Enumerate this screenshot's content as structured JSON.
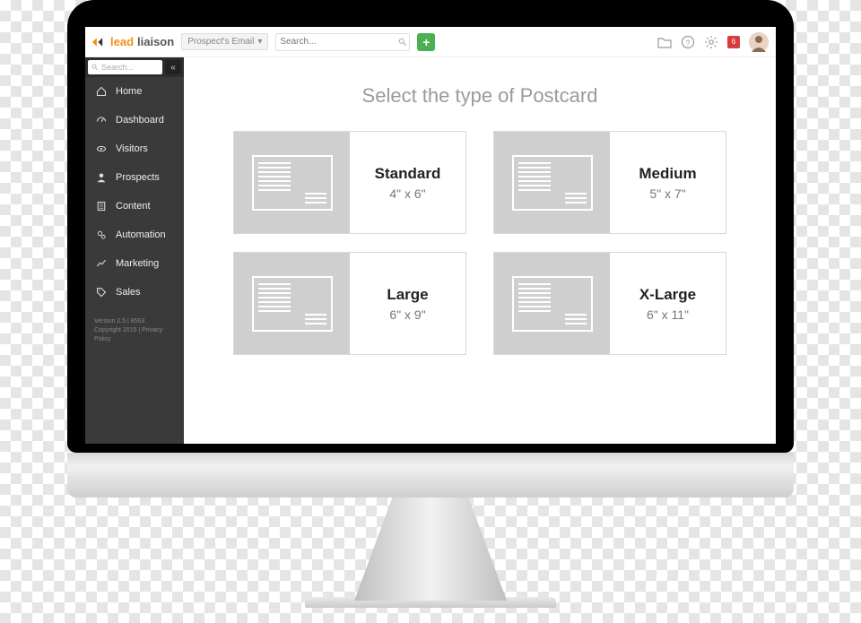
{
  "topbar": {
    "logo_primary": "lead",
    "logo_secondary": "liaison",
    "filter_label": "Prospect's Email",
    "search_placeholder": "Search...",
    "notification_count": "6"
  },
  "sidebar": {
    "search_placeholder": "Search...",
    "items": [
      {
        "icon": "home",
        "label": "Home"
      },
      {
        "icon": "dashboard",
        "label": "Dashboard"
      },
      {
        "icon": "eye",
        "label": "Visitors"
      },
      {
        "icon": "user",
        "label": "Prospects"
      },
      {
        "icon": "file",
        "label": "Content"
      },
      {
        "icon": "gears",
        "label": "Automation"
      },
      {
        "icon": "chart",
        "label": "Marketing"
      },
      {
        "icon": "tag",
        "label": "Sales"
      }
    ],
    "footer_line1": "Version 2.5 | 8563",
    "footer_line2": "Copyright 2015 | Privacy Policy"
  },
  "main": {
    "title": "Select the type of Postcard",
    "cards": [
      {
        "name": "Standard",
        "dimensions": "4\" x 6\""
      },
      {
        "name": "Medium",
        "dimensions": "5\" x 7\""
      },
      {
        "name": "Large",
        "dimensions": "6\" x 9\""
      },
      {
        "name": "X-Large",
        "dimensions": "6\" x 11\""
      }
    ]
  }
}
